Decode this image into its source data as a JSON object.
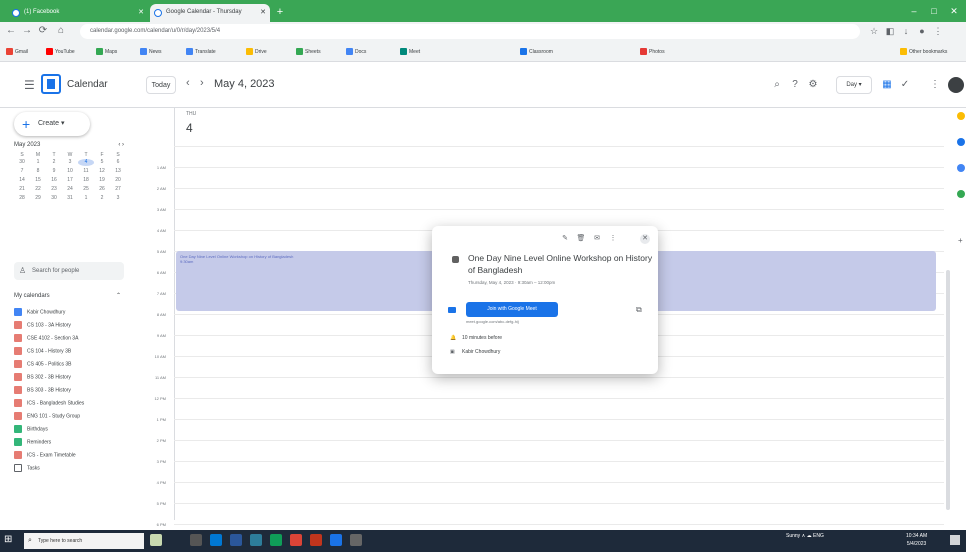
{
  "browser": {
    "tabs": [
      {
        "label": "(1) Facebook"
      },
      {
        "label": "Google Calendar - Thursday"
      }
    ],
    "url": "calendar.google.com/calendar/u/0/r/day/2023/5/4",
    "bookmarks": [
      "Gmail",
      "YouTube",
      "Maps",
      "News",
      "Translate",
      "Drive",
      "Sheets",
      "Docs",
      "Meet",
      "Classroom",
      "Photos",
      "Other bookmarks"
    ]
  },
  "header": {
    "app_title": "Calendar",
    "today_label": "Today",
    "prev": "‹",
    "next": "›",
    "date_title": "May 4, 2023",
    "view_label": "Day ▾"
  },
  "sidebar": {
    "create_label": "Create ▾",
    "mini_month": "May 2023",
    "weekdays": [
      "S",
      "M",
      "T",
      "W",
      "T",
      "F",
      "S"
    ],
    "days": [
      "30",
      "1",
      "2",
      "3",
      "4",
      "5",
      "6",
      "7",
      "8",
      "9",
      "10",
      "11",
      "12",
      "13",
      "14",
      "15",
      "16",
      "17",
      "18",
      "19",
      "20",
      "21",
      "22",
      "23",
      "24",
      "25",
      "26",
      "27",
      "28",
      "29",
      "30",
      "31",
      "1",
      "2",
      "3"
    ],
    "selected_day_index": 4,
    "search_people": "Search for people",
    "my_calendars_title": "My calendars",
    "calendars": [
      {
        "name": "Kabir Chowdhury",
        "color": "#4285f4"
      },
      {
        "name": "CS 103 - 3A History",
        "color": "#e67c73"
      },
      {
        "name": "CSE 4102 - Section 3A",
        "color": "#e67c73"
      },
      {
        "name": "CS 104 - History 3B",
        "color": "#e67c73"
      },
      {
        "name": "CS 405 - Politics 3B",
        "color": "#e67c73"
      },
      {
        "name": "BS 302 - 3B History",
        "color": "#e67c73"
      },
      {
        "name": "BS 303 - 3B History",
        "color": "#e67c73"
      },
      {
        "name": "ICS - Bangladesh Studies",
        "color": "#e67c73"
      },
      {
        "name": "ENG 101 - Study Group",
        "color": "#e67c73"
      },
      {
        "name": "Birthdays",
        "color": "#33b679"
      },
      {
        "name": "Reminders",
        "color": "#33b679"
      },
      {
        "name": "ICS - Exam Timetable",
        "color": "#e67c73"
      },
      {
        "name": "Tasks",
        "color": "#ffffff"
      }
    ]
  },
  "day_view": {
    "weekday": "THU",
    "day_number": "4",
    "time_labels": [
      "1 AM",
      "2 AM",
      "3 AM",
      "4 AM",
      "5 AM",
      "6 AM",
      "7 AM",
      "8 AM",
      "9 AM",
      "10 AM",
      "11 AM",
      "12 PM",
      "1 PM",
      "2 PM",
      "3 PM",
      "4 PM",
      "5 PM",
      "6 PM",
      "7 PM"
    ],
    "event": {
      "summary": "One Day Nine Level Online Workshop on History of Bangladesh",
      "time": "9:30am"
    }
  },
  "popup": {
    "title": "One Day Nine Level Online Workshop on History of Bangladesh",
    "time_text": "Thursday, May 4, 2023 · 9:30am – 12:00pm",
    "join_label": "Join with Google Meet",
    "meet_link": "meet.google.com/abc-defg-hij",
    "reminder": "10 minutes before",
    "calendar": "Kabir Chowdhury"
  },
  "taskbar": {
    "search_placeholder": "Type here to search",
    "tray_text": "Sunny  ∧  ☁  ENG",
    "time": "10:34 AM",
    "date": "5/4/2023"
  }
}
